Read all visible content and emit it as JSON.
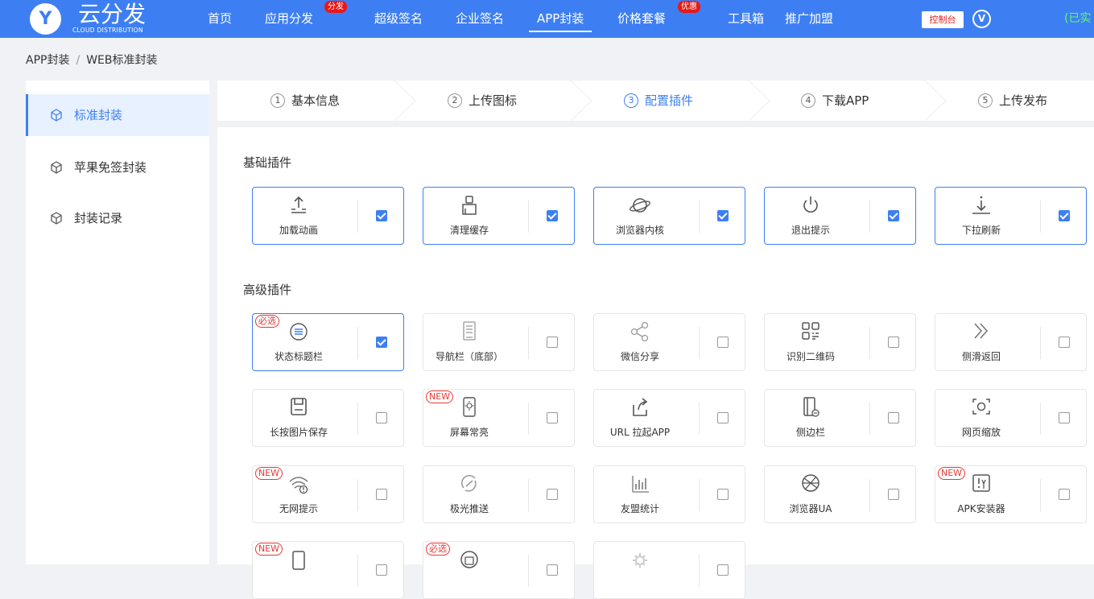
{
  "brand": {
    "logo_letter": "Y",
    "title": "云分发",
    "subtitle": "CLOUD DISTRIBUTION",
    "color": "#3d7ff3"
  },
  "nav": {
    "items": [
      "首页",
      "应用分发",
      "超级签名",
      "企业签名",
      "APP封装",
      "价格套餐",
      "工具箱",
      "推广加盟"
    ],
    "active": "APP封装",
    "badge_fenfa": "分发",
    "badge_youhui": "优惠",
    "console": "控制台",
    "avatar_letter": "V",
    "verified": "(已实"
  },
  "breadcrumb": {
    "root": "APP封装",
    "sep": "/",
    "current": "WEB标准封装"
  },
  "sidebar": {
    "items": [
      "标准封装",
      "苹果免签封装",
      "封装记录"
    ],
    "active": "标准封装"
  },
  "steps": [
    {
      "num": "1",
      "label": "基本信息"
    },
    {
      "num": "2",
      "label": "上传图标"
    },
    {
      "num": "3",
      "label": "配置插件",
      "active": true
    },
    {
      "num": "4",
      "label": "下载APP"
    },
    {
      "num": "5",
      "label": "上传发布"
    }
  ],
  "sections": {
    "basic": "基础插件",
    "advanced": "高级插件"
  },
  "basic_plugins": [
    {
      "label": "加载动画",
      "icon": "upload-icon",
      "checked": true
    },
    {
      "label": "清理缓存",
      "icon": "broom-icon",
      "checked": true
    },
    {
      "label": "浏览器内核",
      "icon": "planet-icon",
      "checked": true
    },
    {
      "label": "退出提示",
      "icon": "power-icon",
      "checked": true
    },
    {
      "label": "下拉刷新",
      "icon": "pull-down-icon",
      "checked": true
    }
  ],
  "advanced_plugins": [
    {
      "label": "状态标题栏",
      "icon": "menu-circle-icon",
      "checked": true,
      "badge": "必选"
    },
    {
      "label": "导航栏（底部）",
      "icon": "document-icon",
      "checked": false
    },
    {
      "label": "微信分享",
      "icon": "share-icon",
      "checked": false
    },
    {
      "label": "识别二维码",
      "icon": "qrcode-icon",
      "checked": false
    },
    {
      "label": "侧滑返回",
      "icon": "double-chevron-icon",
      "checked": false
    },
    {
      "label": "长按图片保存",
      "icon": "save-icon",
      "checked": false
    },
    {
      "label": "屏幕常亮",
      "icon": "phone-bright-icon",
      "checked": false,
      "badge": "NEW"
    },
    {
      "label": "URL 拉起APP",
      "icon": "launch-icon",
      "checked": false
    },
    {
      "label": "侧边栏",
      "icon": "sidebar-icon",
      "checked": false
    },
    {
      "label": "网页缩放",
      "icon": "zoom-icon",
      "checked": false
    },
    {
      "label": "无网提示",
      "icon": "wifi-off-icon",
      "checked": false,
      "badge": "NEW"
    },
    {
      "label": "极光推送",
      "icon": "push-icon",
      "checked": false
    },
    {
      "label": "友盟统计",
      "icon": "bar-chart-icon",
      "checked": false
    },
    {
      "label": "浏览器UA",
      "icon": "globe-icon",
      "checked": false
    },
    {
      "label": "APK安装器",
      "icon": "apk-icon",
      "checked": false,
      "badge": "NEW"
    },
    {
      "label": "",
      "icon": "phone-icon",
      "checked": false,
      "badge": "NEW"
    },
    {
      "label": "",
      "icon": "print-icon",
      "checked": false,
      "badge": "必选"
    },
    {
      "label": "",
      "icon": "gear-icon",
      "checked": false
    }
  ]
}
